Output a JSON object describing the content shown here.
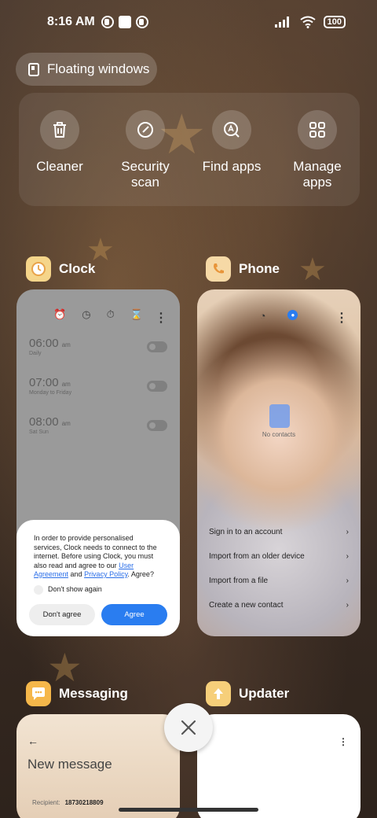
{
  "status_bar": {
    "time": "8:16 AM",
    "battery": "100"
  },
  "floating_windows": {
    "label": "Floating windows"
  },
  "quick_actions": [
    {
      "label": "Cleaner",
      "icon": "trash-icon"
    },
    {
      "label": "Security\nscan",
      "icon": "security-scan-icon"
    },
    {
      "label": "Find apps",
      "icon": "find-apps-icon"
    },
    {
      "label": "Manage\napps",
      "icon": "manage-apps-icon"
    }
  ],
  "apps": {
    "clock": {
      "name": "Clock",
      "alarms": [
        {
          "time": "06:00",
          "ampm": "am",
          "sub": "Daily"
        },
        {
          "time": "07:00",
          "ampm": "am",
          "sub": "Monday to Friday"
        },
        {
          "time": "08:00",
          "ampm": "am",
          "sub": "Sat Sun"
        }
      ],
      "consent": {
        "text_1": "In order to provide personalised services, Clock needs to connect to the internet. Before using Clock, you must also read and agree to our ",
        "link_user_agreement": "User Agreement",
        "text_and": " and ",
        "link_privacy_policy": "Privacy Policy",
        "text_2": ". Agree?",
        "dont_show": "Don't show again",
        "btn_disagree": "Don't agree",
        "btn_agree": "Agree"
      }
    },
    "phone": {
      "name": "Phone",
      "no_contacts": "No contacts",
      "actions": [
        "Sign in to an account",
        "Import from an older device",
        "Import from a file",
        "Create a new contact"
      ]
    },
    "messaging": {
      "name": "Messaging",
      "title": "New message",
      "recipient_label": "Recipient:",
      "recipient_value": "18730218809"
    },
    "updater": {
      "name": "Updater"
    }
  },
  "colors": {
    "accent": "#2a7df0"
  }
}
